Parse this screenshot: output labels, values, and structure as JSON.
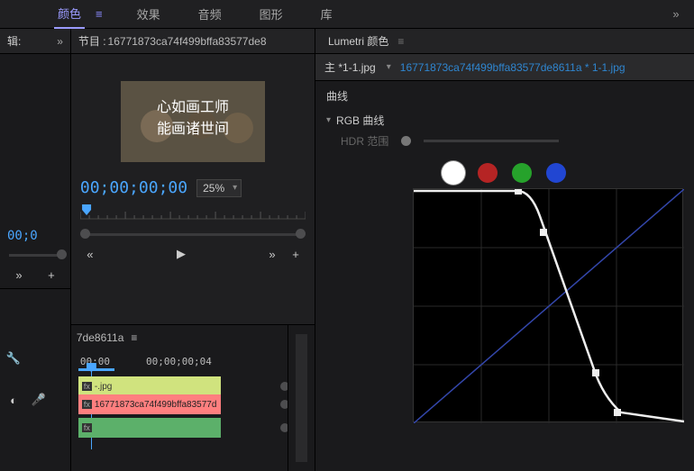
{
  "tabs": {
    "items": [
      "颜色",
      "效果",
      "音频",
      "图形",
      "库"
    ],
    "more": "»",
    "activeIndex": 0
  },
  "edit_panel": {
    "title": "辑:",
    "more": "»",
    "timecode": "00;0"
  },
  "project_panel": {
    "title_prefix": "节目 :",
    "title_name": "16771873ca74f499bffa83577de8",
    "timecode": "00;00;00;00",
    "zoom": "25%",
    "ctrl": {
      "back": "«",
      "play": "▶",
      "fwd": "»",
      "plus": "+"
    }
  },
  "timeline": {
    "tab": "7de8611a",
    "times": [
      "00;00",
      "00;00;00;04"
    ],
    "clips": {
      "v2_label": "-.jpg",
      "v1_label": "16771873ca74f499bffa83577d",
      "a1_label": ""
    },
    "tools": {
      "wrench": "🔧",
      "mic": "🎤",
      "eye": "◐"
    }
  },
  "lumetri": {
    "panel_title": "Lumetri 颜色",
    "master_label": "主",
    "master_clip": "*1-1.jpg",
    "link": "16771873ca74f499bffa83577de8611a * 1-1.jpg",
    "section": "曲线",
    "rgb_title": "RGB 曲线",
    "hdr_label": "HDR 范围"
  }
}
